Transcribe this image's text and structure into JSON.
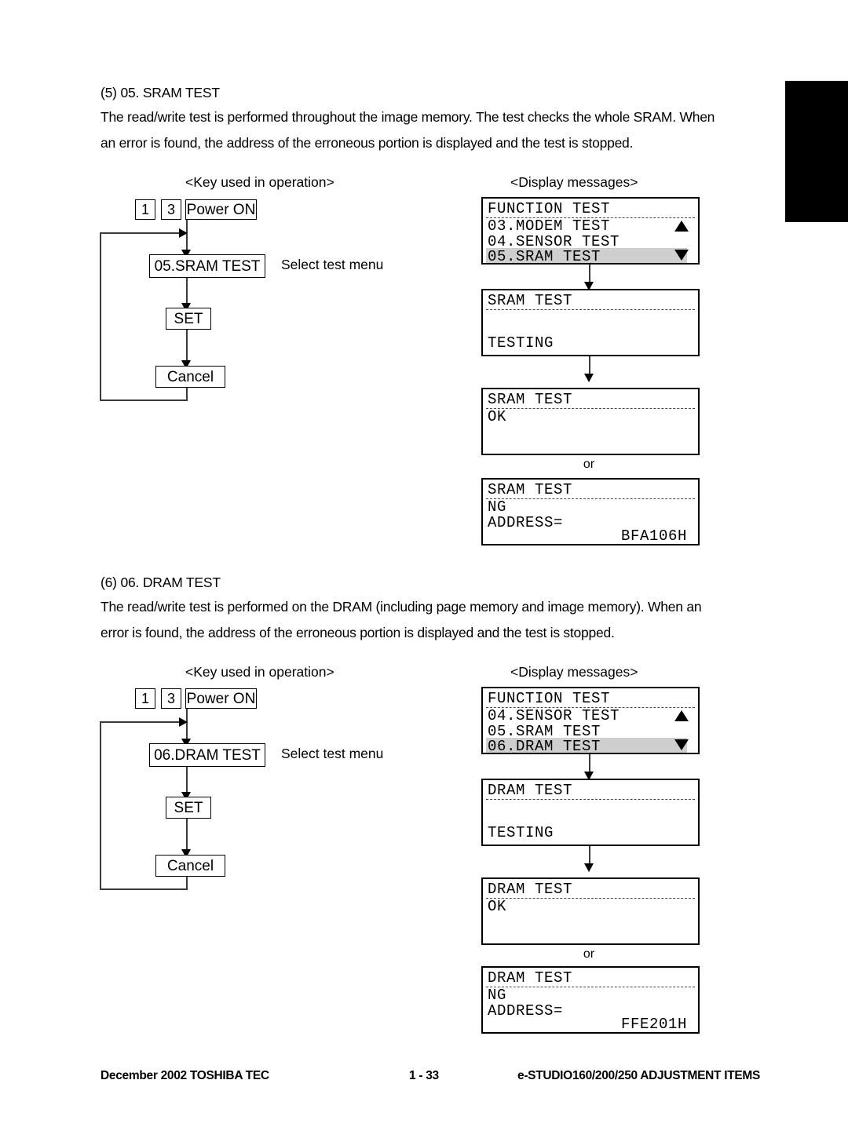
{
  "document": {
    "sections": [
      {
        "id": "sram",
        "heading": "(5) 05. SRAM TEST",
        "paragraph_lines": [
          "The read/write test is performed throughout the image memory.  The test checks the whole SRAM.  When",
          "an error is found, the address of the erroneous portion is displayed and the test is stopped."
        ],
        "key_column_header": "<Key used in operation>",
        "display_column_header": "<Display messages>",
        "keys": {
          "key1": "1",
          "key2": "3",
          "power": "Power ON"
        },
        "menu_box": "05.SRAM TEST",
        "menu_note": "Select test menu",
        "set_box": "SET",
        "cancel_box": "Cancel",
        "or_label": "or",
        "displays": {
          "menu": {
            "title": "FUNCTION TEST",
            "rows": [
              "03.MODEM TEST",
              "04.SENSOR TEST",
              "05.SRAM TEST"
            ],
            "selected_row": "05.SRAM TEST",
            "scroll_up_icon": "triangle-up-icon",
            "scroll_down_icon": "triangle-down-icon"
          },
          "testing": {
            "title": "SRAM TEST",
            "status": "TESTING"
          },
          "ok": {
            "title": "SRAM TEST",
            "status": "OK"
          },
          "ng": {
            "title": "SRAM TEST",
            "status": "NG",
            "address_label": "ADDRESS=",
            "address_value": "BFA106H"
          }
        }
      },
      {
        "id": "dram",
        "heading": "(6) 06. DRAM TEST",
        "paragraph_lines": [
          "The read/write test is performed on the DRAM (including page memory and image memory).  When an",
          "error is found, the address of the erroneous portion is displayed and the test is stopped."
        ],
        "key_column_header": "<Key used in operation>",
        "display_column_header": "<Display messages>",
        "keys": {
          "key1": "1",
          "key2": "3",
          "power": "Power ON"
        },
        "menu_box": "06.DRAM TEST",
        "menu_note": "Select test menu",
        "set_box": "SET",
        "cancel_box": "Cancel",
        "or_label": "or",
        "displays": {
          "menu": {
            "title": "FUNCTION TEST",
            "rows": [
              "04.SENSOR TEST",
              "05.SRAM TEST",
              "06.DRAM TEST"
            ],
            "selected_row": "06.DRAM TEST",
            "scroll_up_icon": "triangle-up-icon",
            "scroll_down_icon": "triangle-down-icon"
          },
          "testing": {
            "title": "DRAM TEST",
            "status": "TESTING"
          },
          "ok": {
            "title": "DRAM TEST",
            "status": "OK"
          },
          "ng": {
            "title": "DRAM TEST",
            "status": "NG",
            "address_label": "ADDRESS=",
            "address_value": "FFE201H"
          }
        }
      }
    ],
    "footer": {
      "left": "December 2002 TOSHIBA TEC",
      "center": "1 - 33",
      "right": "e-STUDIO160/200/250 ADJUSTMENT ITEMS"
    }
  }
}
